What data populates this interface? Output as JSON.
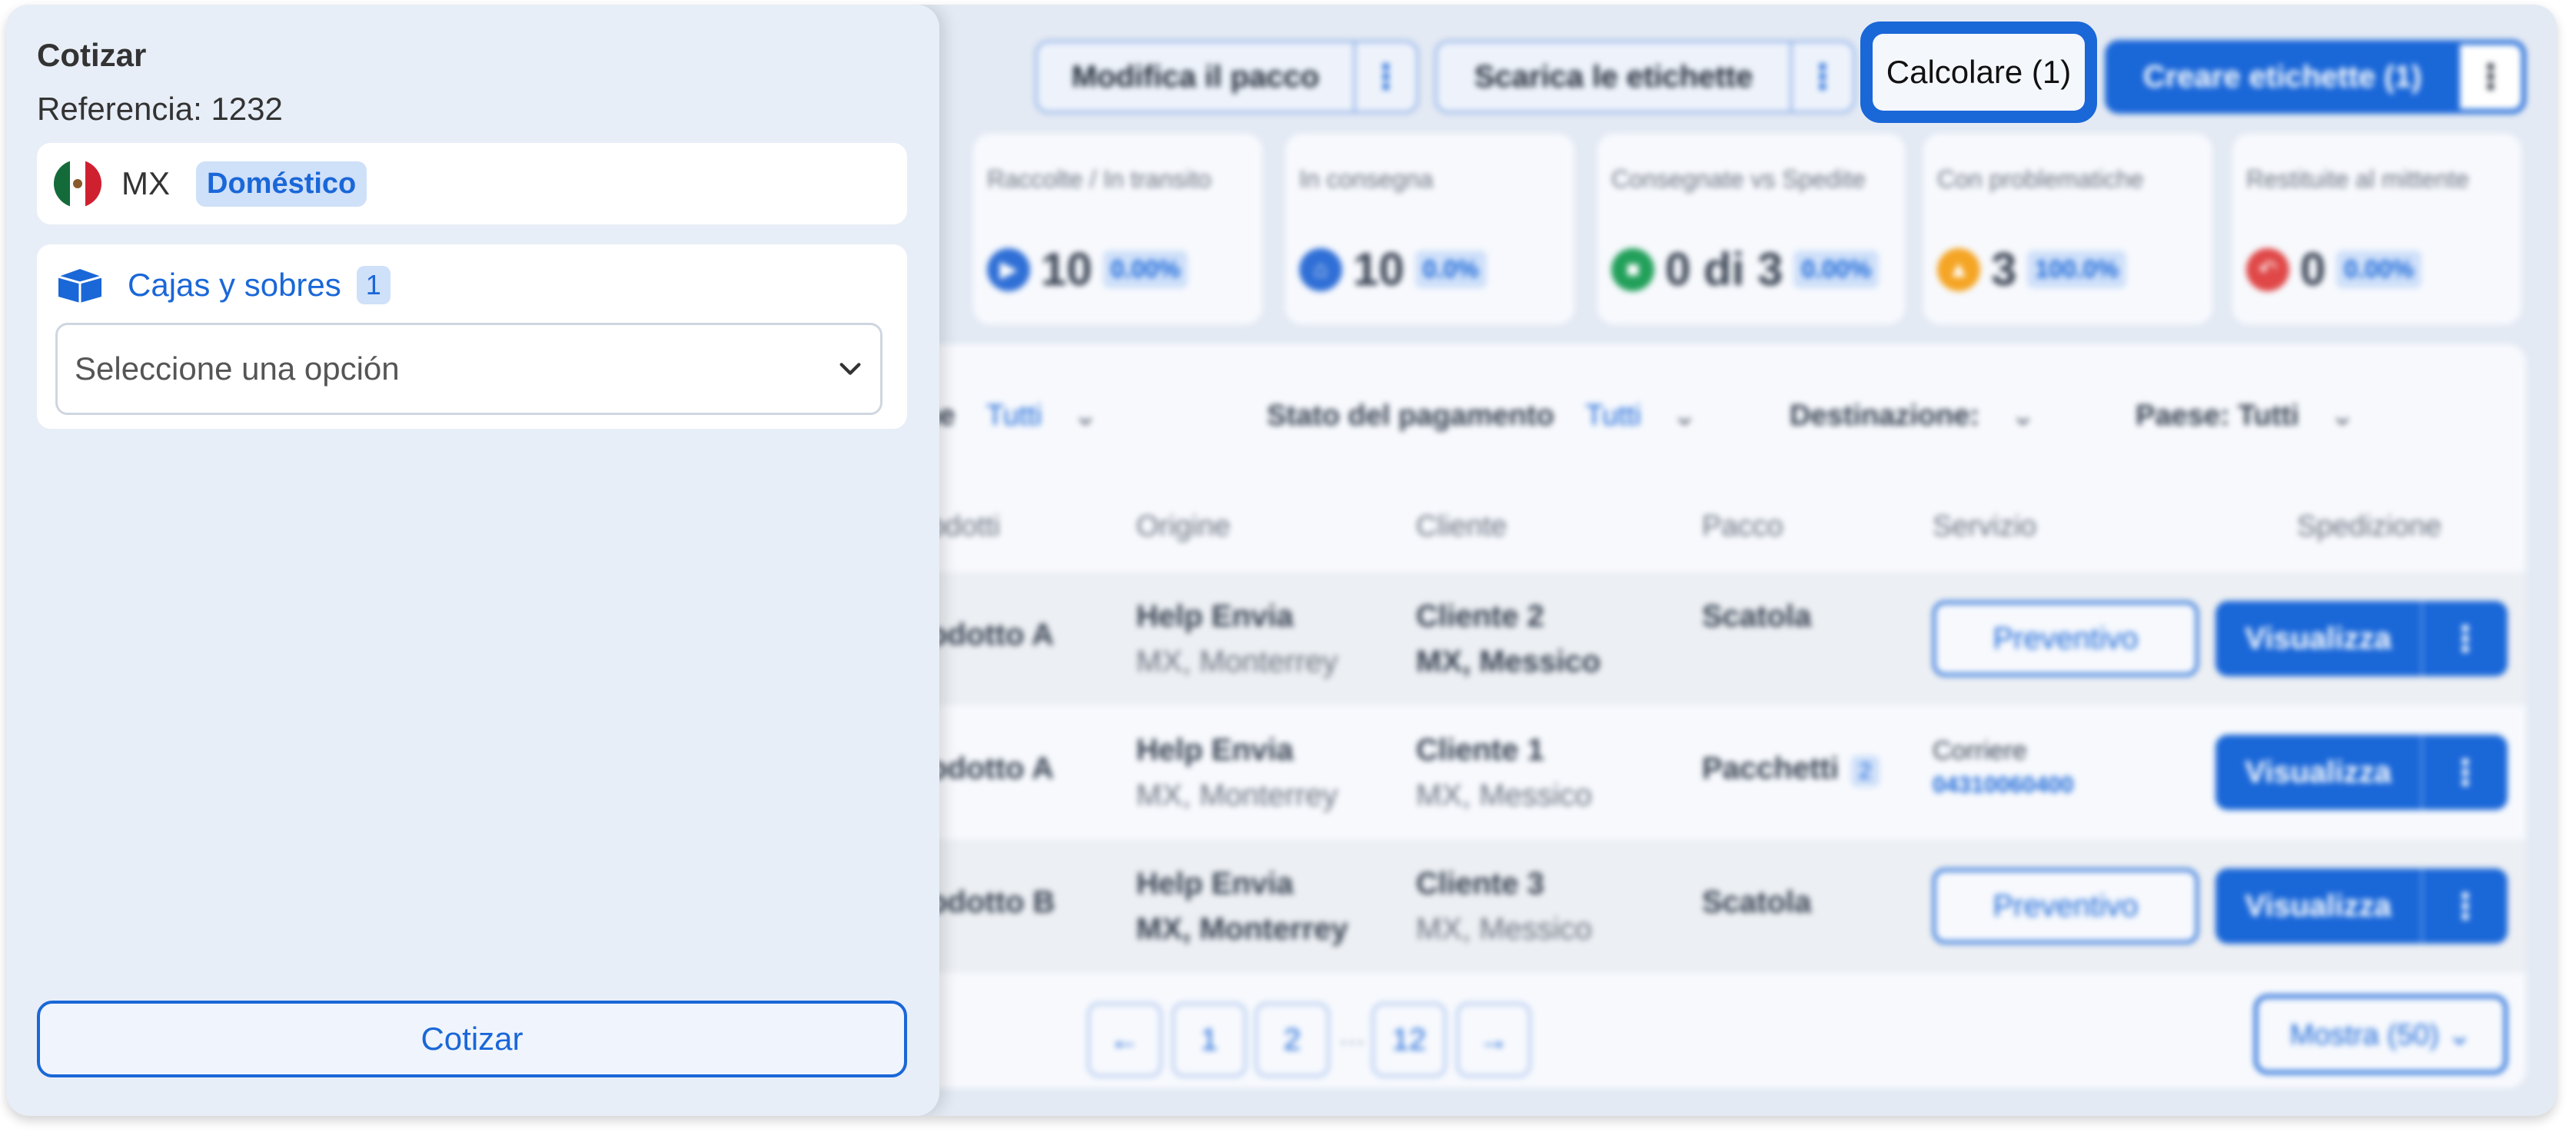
{
  "toolbar": {
    "edit_package": "Modifica il pacco",
    "download_labels": "Scarica le etichette",
    "calculate": "Calcolare (1)",
    "create_labels": "Creare etichette (1)",
    "more": "⋮"
  },
  "stats": [
    {
      "title": "Raccolte / In transito",
      "value": "10",
      "pct": "0.00%",
      "color": "#2f6fd6",
      "icon": "truck-icon"
    },
    {
      "title": "In consegna",
      "value": "10",
      "pct": "0.0%",
      "color": "#2f6fd6",
      "icon": "home-icon"
    },
    {
      "title": "Consegnate vs Spedite",
      "value": "0 di 3",
      "pct": "0.00%",
      "color": "#22a05a",
      "icon": "boxes-icon"
    },
    {
      "title": "Con problematiche",
      "value": "3",
      "pct": "100.0%",
      "color": "#f5a524",
      "icon": "warning-icon"
    },
    {
      "title": "Restituite al mittente",
      "value": "0",
      "pct": "0.00%",
      "color": "#e04848",
      "icon": "return-icon"
    }
  ],
  "filters": {
    "f1_label": "ne",
    "f1_value": "Tutti",
    "payment_label": "Stato del pagamento",
    "payment_value": "Tutti",
    "destination_label": "Destinazione:",
    "country_label": "Paese: Tutti"
  },
  "table": {
    "headers": [
      "odotti",
      "Origine",
      "Cliente",
      "Pacco",
      "Servizio",
      "Spedizione"
    ],
    "rows": [
      {
        "product": "odotto A",
        "origin1": "Help Envia",
        "origin2": "MX, Monterrey",
        "client1": "Cliente 2",
        "client2": "MX, Messico",
        "package": "Scatola",
        "service": "Preventivo"
      },
      {
        "product": "odotto A",
        "origin1": "Help Envia",
        "origin2": "MX, Monterrey",
        "client1": "Cliente 1",
        "client2": "MX, Messico",
        "package": "Pacchetti",
        "package_count": "2",
        "carrier": "Corriere",
        "tracking": "04310060400"
      },
      {
        "product": "odotto B",
        "origin1": "Help Envia",
        "origin2": "MX, Monterrey",
        "client1": "Cliente 3",
        "client2": "MX, Messico",
        "package": "Scatola",
        "service": "Preventivo"
      }
    ],
    "view_label": "Visualizza"
  },
  "pagination": {
    "prev": "←",
    "p1": "1",
    "p2": "2",
    "ellipsis": "...",
    "last": "12",
    "next": "→",
    "show": "Mostra (50) ⌄"
  },
  "sidebar": {
    "title": "Cotizar",
    "reference": "Referencia: 1232",
    "country_code": "MX",
    "badge": "Doméstico",
    "boxes_title": "Cajas y sobres",
    "boxes_count": "1",
    "select_placeholder": "Seleccione una opción",
    "cta": "Cotizar"
  }
}
